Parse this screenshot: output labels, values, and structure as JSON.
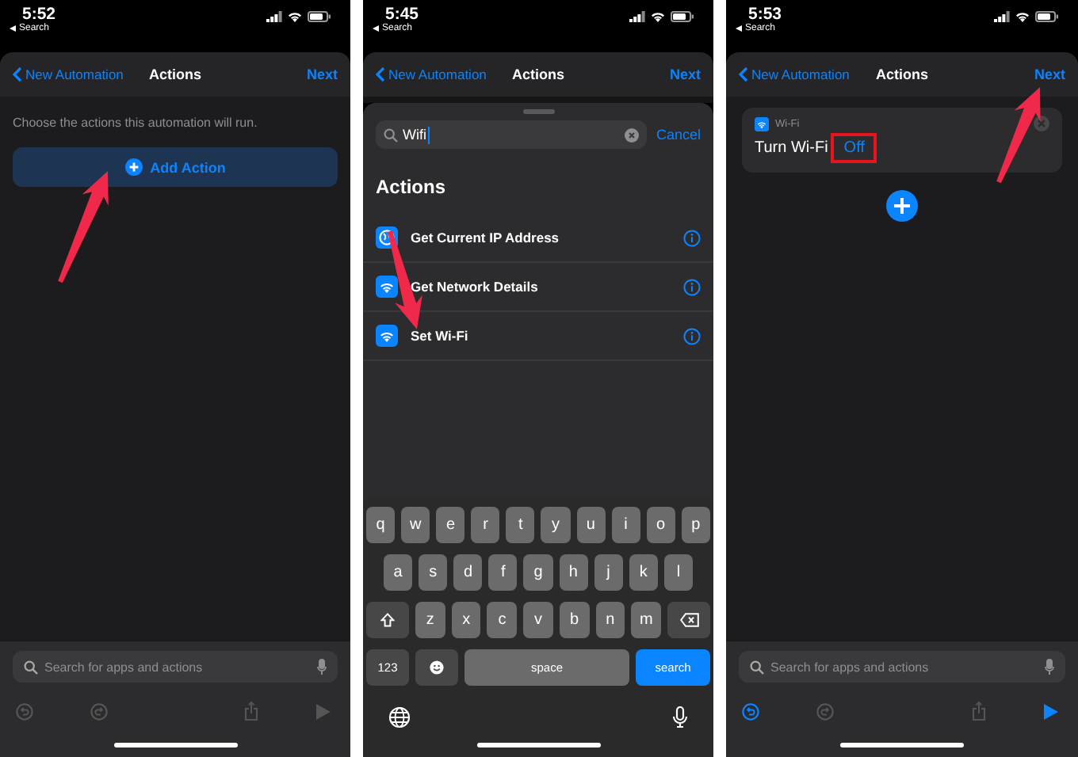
{
  "panels": [
    {
      "kind": "empty",
      "status_bar": {
        "time": "5:52",
        "back": "Search"
      },
      "nav_bar": {
        "back": "New Automation",
        "title": "Actions",
        "action": "Next"
      },
      "hint": "Choose the actions this automation will run.",
      "add_button": "Add Action",
      "arrow": true,
      "bottom": {
        "search_placeholder": "Search for apps and actions",
        "undo_enabled": false,
        "play_enabled": false
      }
    },
    {
      "kind": "search",
      "status_bar": {
        "time": "5:45",
        "back": "Search"
      },
      "nav_bar": {
        "back": "New Automation",
        "title": "Actions",
        "action": "Next"
      },
      "search": {
        "value": "Wifi",
        "cancel": "Cancel"
      },
      "heading": "Actions",
      "actions": [
        {
          "label": "Get Current IP Address",
          "kind": "globe"
        },
        {
          "label": "Get Network Details",
          "kind": "wifi"
        },
        {
          "label": "Set Wi-Fi",
          "kind": "wifi"
        }
      ],
      "arrow": true,
      "keyboard": {
        "rows": [
          [
            "q",
            "w",
            "e",
            "r",
            "t",
            "y",
            "u",
            "i",
            "o",
            "p"
          ],
          [
            "a",
            "s",
            "d",
            "f",
            "g",
            "h",
            "j",
            "k",
            "l"
          ],
          [
            "z",
            "x",
            "c",
            "v",
            "b",
            "n",
            "m"
          ]
        ],
        "numbers": "123",
        "space": "space",
        "go": "search"
      }
    },
    {
      "kind": "action",
      "status_bar": {
        "time": "5:53",
        "back": "Search"
      },
      "nav_bar": {
        "back": "New Automation",
        "title": "Actions",
        "action": "Next"
      },
      "card": {
        "app": "Wi-Fi",
        "action": "Turn Wi-Fi",
        "value": "Off",
        "highlighted": true
      },
      "arrow": true,
      "bottom": {
        "search_placeholder": "Search for apps and actions",
        "undo_enabled": true,
        "play_enabled": true
      }
    }
  ]
}
